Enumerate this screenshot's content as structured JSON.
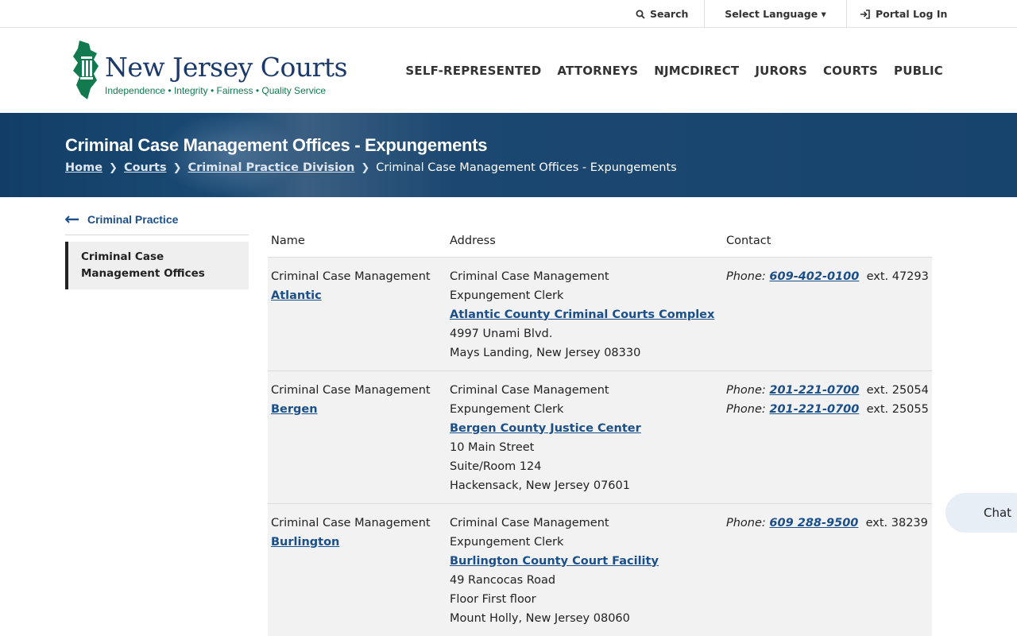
{
  "utility": {
    "search": "Search",
    "language": "Select Language ▾",
    "portal": "Portal Log In"
  },
  "logo": {
    "title": "New Jersey Courts",
    "tagline": "Independence • Integrity • Fairness • Quality Service"
  },
  "nav": [
    "SELF-REPRESENTED",
    "ATTORNEYS",
    "NJMCDIRECT",
    "JURORS",
    "COURTS",
    "PUBLIC"
  ],
  "banner": {
    "title": "Criminal Case Management Offices - Expungements",
    "breadcrumb": [
      "Home",
      "Courts",
      "Criminal Practice Division"
    ],
    "current": "Criminal Case Management Offices - Expungements"
  },
  "sidebar": {
    "back": "Criminal Practice",
    "item": "Criminal Case Management Offices"
  },
  "table": {
    "headers": [
      "Name",
      "Address",
      "Contact"
    ],
    "rows": [
      {
        "name_prefix": "Criminal Case Management",
        "name_link": "Atlantic",
        "addr1": "Criminal Case Management",
        "addr2": "Expungement Clerk",
        "facility": "Atlantic County Criminal Courts Complex",
        "street": [
          "4997 Unami Blvd.",
          "Mays Landing, New Jersey 08330"
        ],
        "contacts": [
          {
            "label": "Phone",
            "number": "609-402-0100",
            "ext": "ext. 47293"
          }
        ]
      },
      {
        "name_prefix": "Criminal Case Management",
        "name_link": "Bergen",
        "addr1": "Criminal Case Management",
        "addr2": "Expungement Clerk",
        "facility": "Bergen County Justice Center",
        "street": [
          "10 Main Street",
          "Suite/Room 124",
          "Hackensack, New Jersey 07601"
        ],
        "contacts": [
          {
            "label": "Phone",
            "number": "201-221-0700",
            "ext": "ext. 25054"
          },
          {
            "label": "Phone",
            "number": "201-221-0700",
            "ext": "ext. 25055"
          }
        ]
      },
      {
        "name_prefix": "Criminal Case Management",
        "name_link": "Burlington",
        "addr1": "Criminal Case Management",
        "addr2": "Expungement Clerk",
        "facility": "Burlington County Court Facility",
        "street": [
          "49 Rancocas Road",
          "Floor First floor",
          "Mount Holly, New Jersey 08060"
        ],
        "contacts": [
          {
            "label": "Phone",
            "number": "609 288-9500",
            "ext": "ext. 38239"
          }
        ]
      }
    ]
  },
  "chat": "Chat",
  "colors": {
    "primary": "#1b4f8a",
    "banner": "#17446d",
    "logo_green": "#117a4f"
  }
}
